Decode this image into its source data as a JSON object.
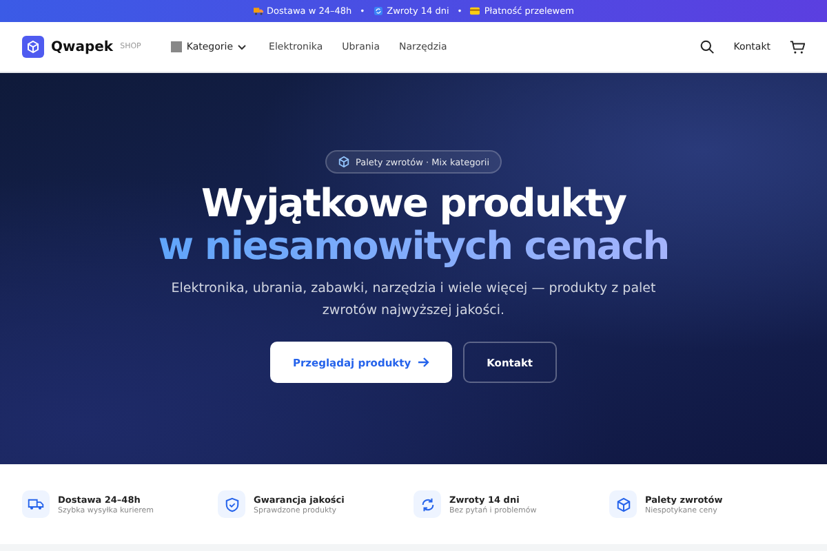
{
  "announcement": [
    {
      "kind": "truck",
      "text": "Dostawa w 24–48h"
    },
    {
      "kind": "refresh",
      "text": "Zwroty 14 dni"
    },
    {
      "kind": "card",
      "text": "Płatność przelewem"
    }
  ],
  "separator": "•",
  "nav": {
    "brand": "Qwapek",
    "brand_tag": "SHOP",
    "categories": "Kategorie",
    "links": [
      "Elektronika",
      "Ubrania",
      "Narzędzia"
    ],
    "contact": "Kontakt"
  },
  "hero": {
    "badge": "Palety zwrotów · Mix kategorii",
    "title_line1": "Wyjątkowe produkty",
    "title_line2": "w niesamowitych cenach",
    "subtitle": "Elektronika, ubrania, zabawki, narzędzia i wiele więcej — produkty z palet zwrotów najwyższej jakości.",
    "primary_button": "Przeglądaj produkty",
    "secondary_button": "Kontakt"
  },
  "features": [
    {
      "kind": "truck",
      "title": "Dostawa 24–48h",
      "subtitle": "Szybka wysyłka kurierem"
    },
    {
      "kind": "shield",
      "title": "Gwarancja jakości",
      "subtitle": "Sprawdzone produkty"
    },
    {
      "kind": "refresh",
      "title": "Zwroty 14 dni",
      "subtitle": "Bez pytań i problemów"
    },
    {
      "kind": "box",
      "title": "Palety zwrotów",
      "subtitle": "Niespotykane ceny"
    }
  ]
}
